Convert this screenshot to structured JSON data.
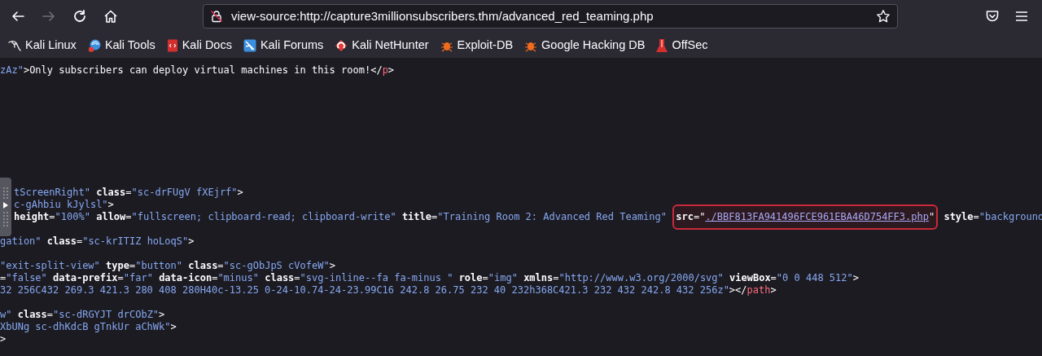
{
  "toolbar": {
    "back_disabled": false,
    "forward_disabled": true,
    "url": "view-source:http://capture3millionsubscribers.thm/advanced_red_teaming.php"
  },
  "bookmarks": [
    {
      "label": "Kali Linux",
      "kind": "dragon"
    },
    {
      "label": "Kali Tools",
      "kind": "tools"
    },
    {
      "label": "Kali Docs",
      "kind": "docs"
    },
    {
      "label": "Kali Forums",
      "kind": "forums"
    },
    {
      "label": "Kali NetHunter",
      "kind": "nethunter"
    },
    {
      "label": "Exploit-DB",
      "kind": "bug"
    },
    {
      "label": "Google Hacking DB",
      "kind": "bug"
    },
    {
      "label": "OffSec",
      "kind": "offsec"
    }
  ],
  "source_lines": [
    {
      "kind": "code",
      "segments": [
        {
          "kind": "value",
          "text": "zAz\""
        },
        {
          "kind": "punct",
          "text": ">"
        },
        {
          "kind": "text",
          "text": "Only subscribers can deploy virtual machines in this room!</"
        },
        {
          "kind": "tag",
          "text": "p"
        },
        {
          "kind": "punct",
          "text": ">"
        }
      ]
    },
    {
      "kind": "blank"
    },
    {
      "kind": "blank"
    },
    {
      "kind": "blank"
    },
    {
      "kind": "blank"
    },
    {
      "kind": "blank"
    },
    {
      "kind": "blank"
    },
    {
      "kind": "blank"
    },
    {
      "kind": "blank"
    },
    {
      "kind": "blank"
    },
    {
      "kind": "beside-handle",
      "segments": [
        {
          "kind": "value",
          "text": "tScreenRight\""
        },
        {
          "kind": "attr",
          "text": "class"
        },
        {
          "kind": "punct",
          "text": "="
        },
        {
          "kind": "value",
          "text": "\"sc-drFUgV fXEjrf\""
        },
        {
          "kind": "punct",
          "text": ">"
        }
      ]
    },
    {
      "kind": "beside-handle",
      "segments": [
        {
          "kind": "value",
          "text": "c-gAhbiu kJylsl\""
        },
        {
          "kind": "punct",
          "text": ">"
        }
      ]
    },
    {
      "kind": "beside-handle",
      "segments": [
        {
          "kind": "attr",
          "text": "height"
        },
        {
          "kind": "punct",
          "text": "="
        },
        {
          "kind": "value",
          "text": "\"100%\""
        },
        {
          "kind": "attr",
          "text": "allow"
        },
        {
          "kind": "punct",
          "text": "="
        },
        {
          "kind": "value",
          "text": "\"fullscreen; clipboard-read; clipboard-write\""
        },
        {
          "kind": "attr",
          "text": "title"
        },
        {
          "kind": "punct",
          "text": "="
        },
        {
          "kind": "value",
          "text": "\"Training Room 2: Advanced Red Teaming\""
        },
        {
          "kind": "box",
          "children": [
            {
              "kind": "attr",
              "text": "src"
            },
            {
              "kind": "punct",
              "text": "=\""
            },
            {
              "kind": "link",
              "text": "./BBF813FA941496FCE961EBA46D754FF3.php"
            },
            {
              "kind": "punct",
              "text": "\""
            }
          ]
        },
        {
          "kind": "attr",
          "text": "style"
        },
        {
          "kind": "punct",
          "text": "="
        },
        {
          "kind": "value",
          "text": "\"background"
        }
      ]
    },
    {
      "kind": "blank"
    },
    {
      "kind": "code",
      "segments": [
        {
          "kind": "value",
          "text": "gation\""
        },
        {
          "kind": "attr",
          "text": "class"
        },
        {
          "kind": "punct",
          "text": "="
        },
        {
          "kind": "value",
          "text": "\"sc-krITIZ hoLoqS\""
        },
        {
          "kind": "punct",
          "text": ">"
        }
      ]
    },
    {
      "kind": "blank"
    },
    {
      "kind": "code",
      "segments": [
        {
          "kind": "value",
          "text": "\"exit-split-view\""
        },
        {
          "kind": "attr",
          "text": "type"
        },
        {
          "kind": "punct",
          "text": "="
        },
        {
          "kind": "value",
          "text": "\"button\""
        },
        {
          "kind": "attr",
          "text": "class"
        },
        {
          "kind": "punct",
          "text": "="
        },
        {
          "kind": "value",
          "text": "\"sc-gObJpS cVofeW\""
        },
        {
          "kind": "punct",
          "text": ">"
        }
      ]
    },
    {
      "kind": "code",
      "segments": [
        {
          "kind": "punct",
          "text": "="
        },
        {
          "kind": "value",
          "text": "\"false\""
        },
        {
          "kind": "attr",
          "text": "data-prefix"
        },
        {
          "kind": "punct",
          "text": "="
        },
        {
          "kind": "value",
          "text": "\"far\""
        },
        {
          "kind": "attr",
          "text": "data-icon"
        },
        {
          "kind": "punct",
          "text": "="
        },
        {
          "kind": "value",
          "text": "\"minus\""
        },
        {
          "kind": "attr",
          "text": "class"
        },
        {
          "kind": "punct",
          "text": "="
        },
        {
          "kind": "value",
          "text": "\"svg-inline--fa fa-minus \""
        },
        {
          "kind": "attr",
          "text": "role"
        },
        {
          "kind": "punct",
          "text": "="
        },
        {
          "kind": "value",
          "text": "\"img\""
        },
        {
          "kind": "attr",
          "text": "xmlns"
        },
        {
          "kind": "punct",
          "text": "="
        },
        {
          "kind": "value",
          "text": "\"http://www.w3.org/2000/svg\""
        },
        {
          "kind": "attr",
          "text": "viewBox"
        },
        {
          "kind": "punct",
          "text": "="
        },
        {
          "kind": "value",
          "text": "\"0 0 448 512\""
        },
        {
          "kind": "punct",
          "text": ">"
        }
      ]
    },
    {
      "kind": "code",
      "segments": [
        {
          "kind": "value",
          "text": "32 256C432 269.3 421.3 280 408 280H40c-13.25 0-24-10.74-24-23.99C16 242.8 26.75 232 40 232h368C421.3 232 432 242.8 432 256z\""
        },
        {
          "kind": "punct",
          "text": "></"
        },
        {
          "kind": "tag",
          "text": "path"
        },
        {
          "kind": "punct",
          "text": ">"
        }
      ]
    },
    {
      "kind": "blank"
    },
    {
      "kind": "code",
      "segments": [
        {
          "kind": "value",
          "text": "w\""
        },
        {
          "kind": "attr",
          "text": "class"
        },
        {
          "kind": "punct",
          "text": "="
        },
        {
          "kind": "value",
          "text": "\"sc-dRGYJT drCObZ\""
        },
        {
          "kind": "punct",
          "text": ">"
        }
      ]
    },
    {
      "kind": "code",
      "segments": [
        {
          "kind": "value",
          "text": "XbUNg sc-dhKdcB gTnkUr aChWk\""
        },
        {
          "kind": "punct",
          "text": ">"
        }
      ]
    },
    {
      "kind": "code",
      "segments": [
        {
          "kind": "punct",
          "text": ">"
        }
      ]
    }
  ]
}
